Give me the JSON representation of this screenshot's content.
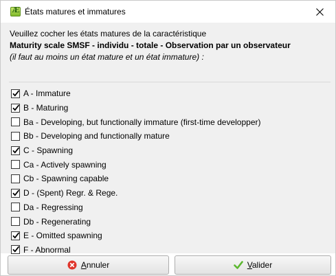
{
  "window": {
    "title": "États matures et immatures",
    "app_icon": "app-logo-icon",
    "close_icon": "close-icon"
  },
  "intro": {
    "line1": "Veuillez cocher les états matures de la caractéristique",
    "line2": "Maturity scale SMSF - individu - totale - Observation par un observateur",
    "line3": "(il faut au moins un état mature et un état immature) :"
  },
  "states": [
    {
      "label": "A - Immature",
      "checked": true
    },
    {
      "label": "B - Maturing",
      "checked": true
    },
    {
      "label": "Ba - Developing, but functionally immature (first-time developper)",
      "checked": false
    },
    {
      "label": "Bb - Developing and functionally mature",
      "checked": false
    },
    {
      "label": "C - Spawning",
      "checked": true
    },
    {
      "label": "Ca - Actively spawning",
      "checked": false
    },
    {
      "label": "Cb - Spawning capable",
      "checked": false
    },
    {
      "label": "D - (Spent) Regr. & Rege.",
      "checked": true
    },
    {
      "label": "Da - Regressing",
      "checked": false
    },
    {
      "label": "Db - Regenerating",
      "checked": false
    },
    {
      "label": "E - Omitted spawning",
      "checked": true
    },
    {
      "label": "F - Abnormal",
      "checked": true
    }
  ],
  "buttons": {
    "cancel": {
      "first_letter": "A",
      "rest": "nnuler",
      "icon": "cancel-x-icon",
      "color": "#e0352b"
    },
    "ok": {
      "first_letter": "V",
      "rest": "alider",
      "icon": "checkmark-icon",
      "color": "#5cb82f"
    }
  }
}
